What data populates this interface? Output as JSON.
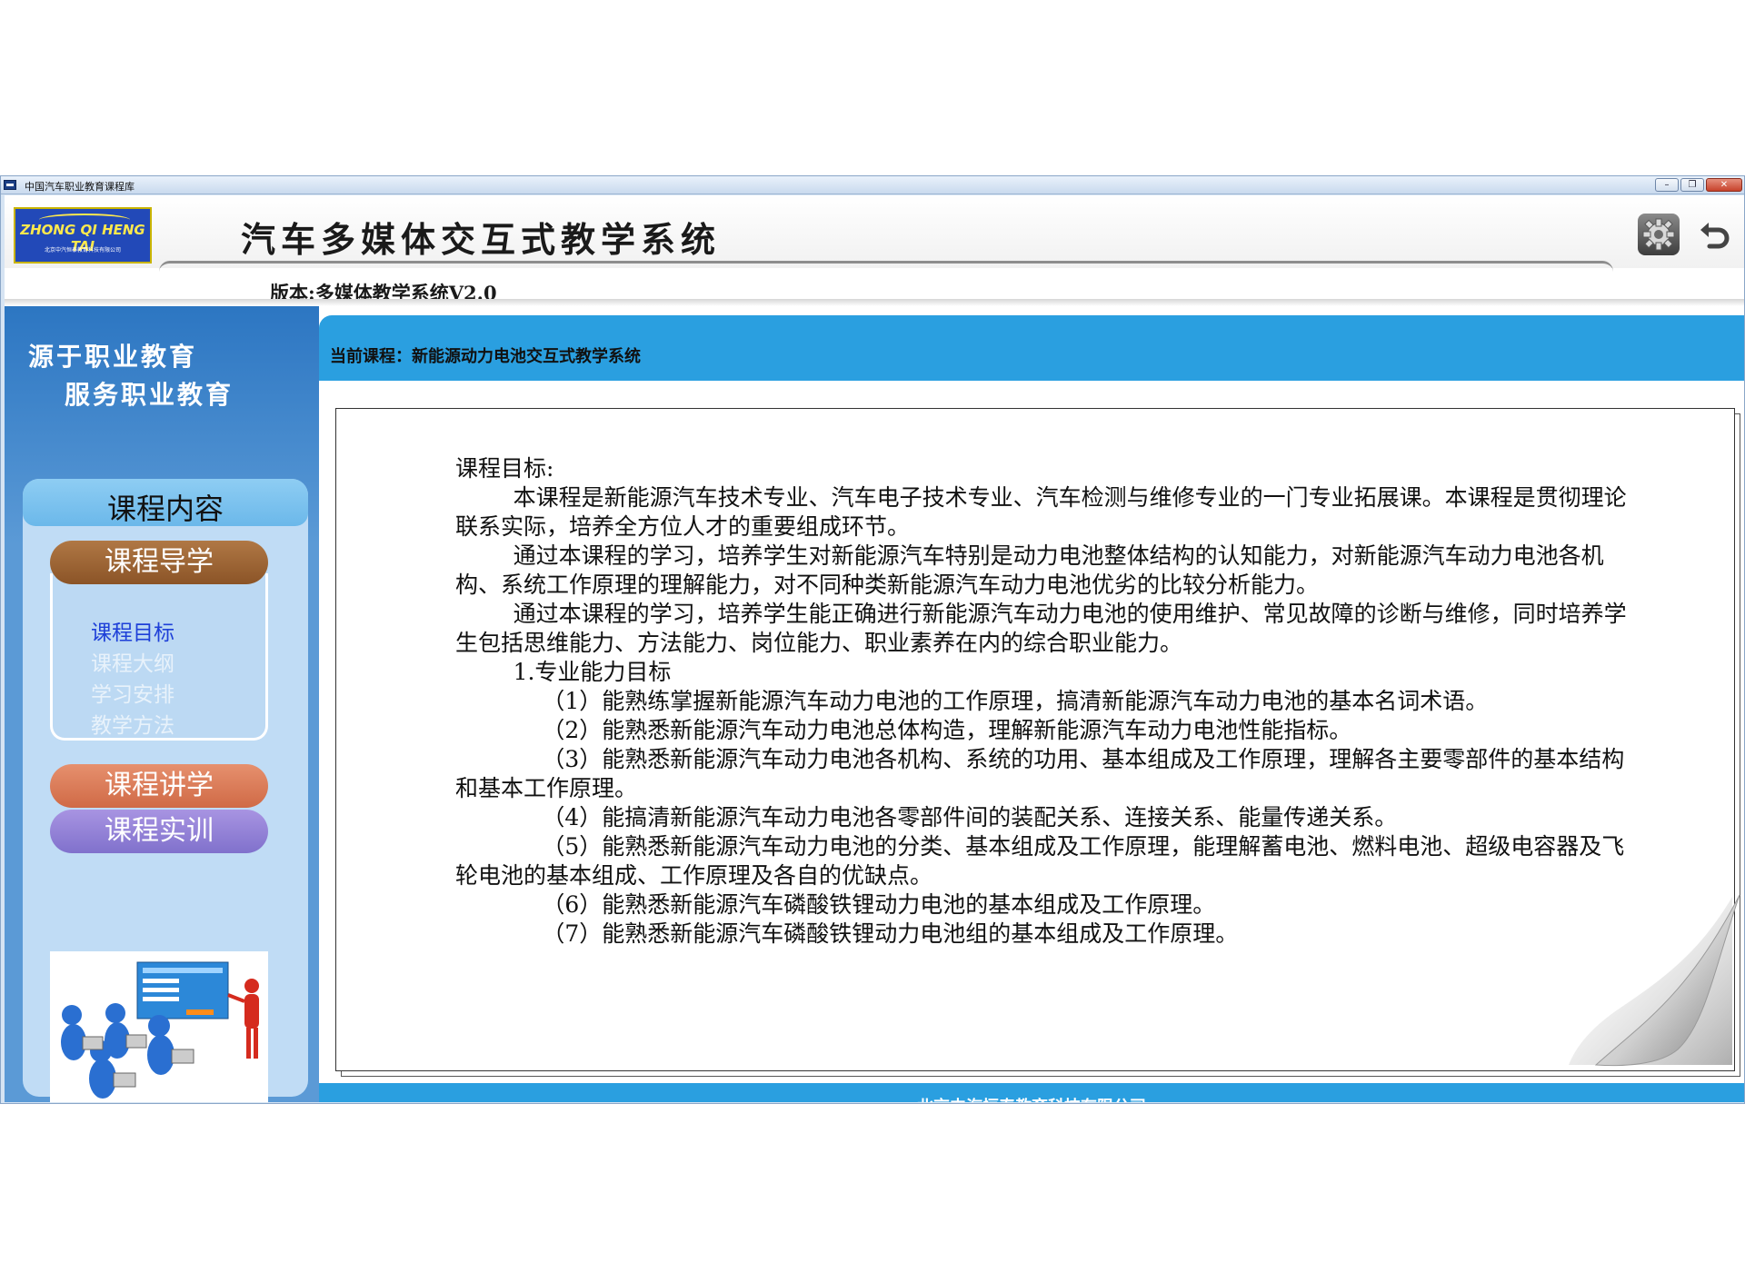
{
  "window": {
    "title": "中国汽车职业教育课程库",
    "min_label": "–",
    "max_label": "❐",
    "close_label": "✕"
  },
  "header": {
    "logo_text": "ZHONG QI HENG TAI",
    "logo_subtext": "北京中汽恒泰教育科技有限公司",
    "app_title": "汽车多媒体交互式教学系统",
    "version": "版本:多媒体教学系统V2.0"
  },
  "sidebar": {
    "slogan_line1": "源于职业教育",
    "slogan_line2": "服务职业教育",
    "panel_title": "课程内容",
    "guide_label": "课程导学",
    "sub_items": [
      "课程目标",
      "课程大纲",
      "学习安排",
      "教学方法"
    ],
    "lecture_label": "课程讲学",
    "training_label": "课程实训"
  },
  "main": {
    "current_course": "当前课程：新能源动力电池交互式教学系统",
    "paragraphs": [
      "课程目标:",
      "        本课程是新能源汽车技术专业、汽车电子技术专业、汽车检测与维修专业的一门专业拓展课。本课程是贯彻理论联系实际，培养全方位人才的重要组成环节。",
      "        通过本课程的学习，培养学生对新能源汽车特别是动力电池整体结构的认知能力，对新能源汽车动力电池各机构、系统工作原理的理解能力，对不同种类新能源汽车动力电池优劣的比较分析能力。",
      "        通过本课程的学习，培养学生能正确进行新能源汽车动力电池的使用维护、常见故障的诊断与维修，同时培养学生包括思维能力、方法能力、岗位能力、职业素养在内的综合职业能力。",
      "        1.专业能力目标",
      "            （1）能熟练掌握新能源汽车动力电池的工作原理，搞清新能源汽车动力电池的基本名词术语。",
      "            （2）能熟悉新能源汽车动力电池总体构造，理解新能源汽车动力电池性能指标。",
      "            （3）能熟悉新能源汽车动力电池各机构、系统的功用、基本组成及工作原理，理解各主要零部件的基本结构和基本工作原理。",
      "            （4）能搞清新能源汽车动力电池各零部件间的装配关系、连接关系、能量传递关系。",
      "            （5）能熟悉新能源汽车动力电池的分类、基本组成及工作原理，能理解蓄电池、燃料电池、超级电容器及飞轮电池的基本组成、工作原理及各自的优缺点。",
      "            （6）能熟悉新能源汽车磷酸铁锂动力电池的基本组成及工作原理。",
      "            （7）能熟悉新能源汽车磷酸铁锂动力电池组的基本组成及工作原理。"
    ]
  },
  "footer": {
    "company": "北京中汽恒泰教育科技有限公司"
  },
  "colors": {
    "accent_blue": "#2a9fe0",
    "sidebar_blue": "#5b9ad6",
    "guide_brown": "#9b6132",
    "lecture_orange": "#d9774f",
    "training_purple": "#8c7cd4",
    "active_link": "#1e40d8"
  },
  "icons": {
    "settings": "gear-icon",
    "back": "back-arrow-icon"
  }
}
